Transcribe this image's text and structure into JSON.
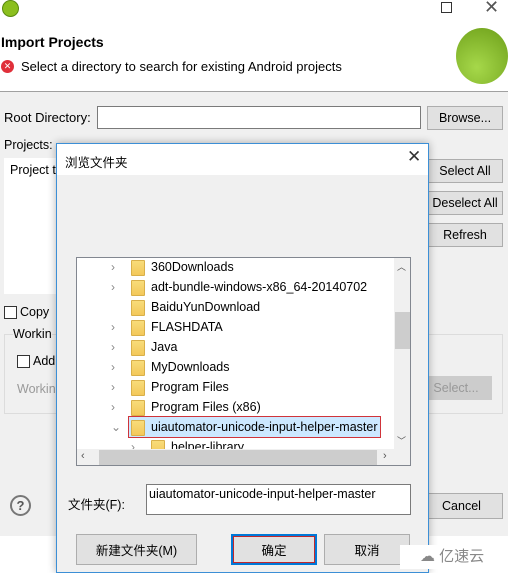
{
  "window": {
    "title": "Import Projects",
    "message": "Select a directory to search for existing Android projects"
  },
  "form": {
    "root_directory_label": "Root Directory:",
    "root_directory_value": "",
    "browse": "Browse...",
    "projects_label": "Projects:",
    "project_column": "Project t",
    "select_all": "Select All",
    "deselect_all": "Deselect All",
    "refresh": "Refresh",
    "copy_label": "Copy",
    "working_sets_label": "Workin",
    "add_label": "Add",
    "working_label": "Workin",
    "select_btn": "Select...",
    "cancel": "Cancel"
  },
  "dialog": {
    "title": "浏览文件夹",
    "folder_label": "文件夹(F):",
    "folder_value": "uiautomator-unicode-input-helper-master",
    "new_folder": "新建文件夹(M)",
    "ok": "确定",
    "cancel": "取消",
    "tree": [
      {
        "name": "360Downloads",
        "expander": "collapsed"
      },
      {
        "name": "adt-bundle-windows-x86_64-20140702",
        "expander": "collapsed"
      },
      {
        "name": "BaiduYunDownload",
        "expander": "none"
      },
      {
        "name": "FLASHDATA",
        "expander": "collapsed"
      },
      {
        "name": "Java",
        "expander": "collapsed"
      },
      {
        "name": "MyDownloads",
        "expander": "collapsed"
      },
      {
        "name": "Program Files",
        "expander": "collapsed"
      },
      {
        "name": "Program Files (x86)",
        "expander": "collapsed"
      },
      {
        "name": "uiautomator-unicode-input-helper-master",
        "expander": "expanded",
        "selected": true
      },
      {
        "name": "helper-library",
        "expander": "collapsed",
        "child": true
      }
    ]
  },
  "watermark": "亿速云",
  "colors": {
    "accent": "#0078d7",
    "selection": "#cce8ff",
    "error": "#e0303a",
    "android": "#8bc34a"
  }
}
